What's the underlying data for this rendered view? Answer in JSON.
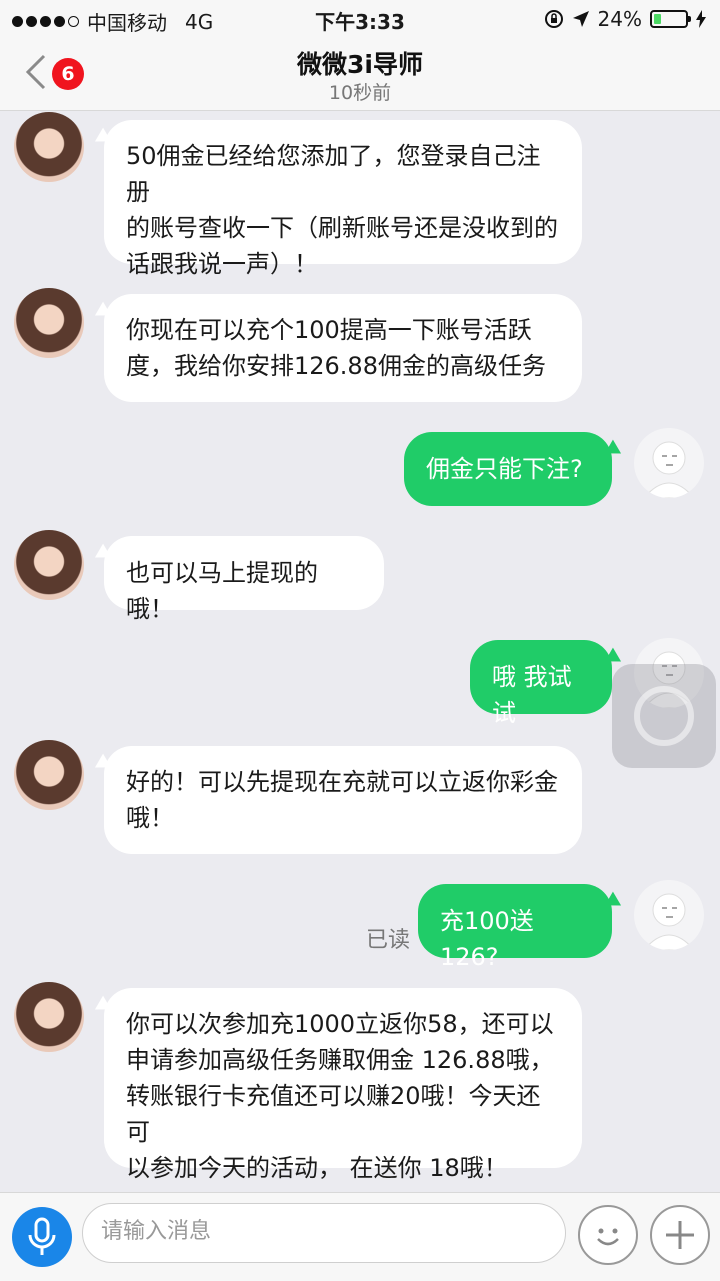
{
  "status_bar": {
    "carrier": "中国移动",
    "network": "4G",
    "time": "下午3:33",
    "battery_pct": "24%",
    "battery_level": 0.24
  },
  "header": {
    "title": "微微3i导师",
    "subtitle": "10秒前",
    "unread_count": "6"
  },
  "messages": [
    {
      "from": "her",
      "text_lines": [
        "50佣金已经给您添加了，您登录自己注册",
        "的账号查收一下（刷新账号还是没收到的",
        "话跟我说一声）！"
      ]
    },
    {
      "from": "her",
      "text_lines": [
        "你现在可以充个100提高一下账号活跃",
        "度，我给你安排126.88佣金的高级任务"
      ]
    },
    {
      "from": "me",
      "text_lines": [
        "佣金只能下注?"
      ]
    },
    {
      "from": "her",
      "text_lines": [
        "也可以马上提现的哦！"
      ]
    },
    {
      "from": "me",
      "text_lines": [
        "哦 我试试"
      ]
    },
    {
      "from": "her",
      "text_lines": [
        "好的！可以先提现在充就可以立返你彩金",
        "哦！"
      ]
    },
    {
      "from": "me",
      "text_lines": [
        "充100送126?"
      ],
      "read_label": "已读"
    },
    {
      "from": "her",
      "text_lines": [
        "你可以次参加充1000立返你58，还可以",
        "申请参加高级任务赚取佣金 126.88哦，",
        "转账银行卡充值还可以赚20哦！今天还可",
        "以参加今天的活动， 在送你 18哦！"
      ]
    }
  ],
  "input_bar": {
    "placeholder": "请输入消息"
  },
  "colors": {
    "outgoing_bubble": "#20cc68",
    "badge": "#f0141e",
    "mic": "#1a86e8"
  }
}
